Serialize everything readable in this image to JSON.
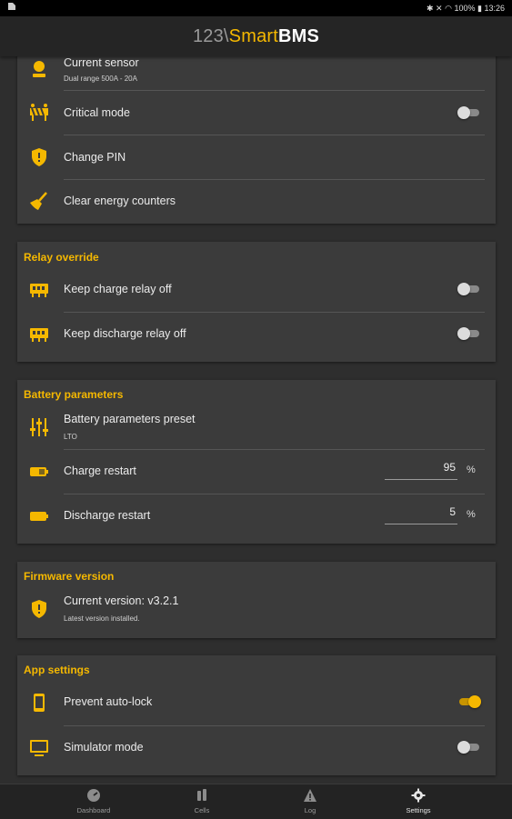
{
  "status_bar": {
    "left_icon": "sd-card-icon",
    "battery": "100%",
    "time": "13:26"
  },
  "app_bar": {
    "logo_part1": "123\\",
    "logo_part2": "Smart",
    "logo_part3": "BMS"
  },
  "colors": {
    "accent": "#f5b800",
    "card": "#3b3b3b",
    "background": "#2e2e2e"
  },
  "general_card": {
    "current_sensor_label": "Current sensor",
    "current_sensor_value": "Dual range 500A - 20A",
    "critical_mode_label": "Critical mode",
    "critical_mode_on": false,
    "change_pin_label": "Change PIN",
    "clear_energy_label": "Clear energy counters"
  },
  "relay_override": {
    "title": "Relay override",
    "keep_charge_label": "Keep charge relay off",
    "keep_charge_on": false,
    "keep_discharge_label": "Keep discharge relay off",
    "keep_discharge_on": false
  },
  "battery_parameters": {
    "title": "Battery parameters",
    "preset_label": "Battery parameters preset",
    "preset_value": "LTO",
    "charge_restart_label": "Charge restart",
    "charge_restart_value": "95",
    "charge_restart_unit": "%",
    "discharge_restart_label": "Discharge restart",
    "discharge_restart_value": "5",
    "discharge_restart_unit": "%"
  },
  "firmware": {
    "title": "Firmware version",
    "current_label": "Current version: v3.2.1",
    "status": "Latest version installed."
  },
  "app_settings": {
    "title": "App settings",
    "prevent_autolock_label": "Prevent auto-lock",
    "prevent_autolock_on": true,
    "simulator_label": "Simulator mode",
    "simulator_on": false
  },
  "bottom_nav": [
    {
      "label": "Dashboard",
      "icon": "gauge-icon"
    },
    {
      "label": "Cells",
      "icon": "cells-icon"
    },
    {
      "label": "Log",
      "icon": "warning-icon"
    },
    {
      "label": "Settings",
      "icon": "gear-icon",
      "active": true
    }
  ]
}
